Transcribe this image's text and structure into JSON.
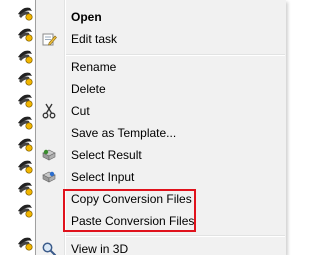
{
  "menu": {
    "items": [
      {
        "label": "Open",
        "icon": ""
      },
      {
        "label": "Edit task",
        "icon": "edit-task-icon"
      },
      {
        "label": "Rename",
        "icon": ""
      },
      {
        "label": "Delete",
        "icon": ""
      },
      {
        "label": "Cut",
        "icon": "scissors-icon"
      },
      {
        "label": "Save as Template...",
        "icon": ""
      },
      {
        "label": "Select Result",
        "icon": "select-result-icon"
      },
      {
        "label": "Select Input",
        "icon": "select-input-icon"
      },
      {
        "label": "Copy Conversion Files",
        "icon": ""
      },
      {
        "label": "Paste Conversion Files",
        "icon": ""
      },
      {
        "label": "View in 3D",
        "icon": "view-3d-magnifier-icon"
      }
    ]
  },
  "tree": {
    "icon": "task-node-icon"
  },
  "colors": {
    "menu_background": "#f1f1f1",
    "highlight_border": "#e0121c"
  }
}
